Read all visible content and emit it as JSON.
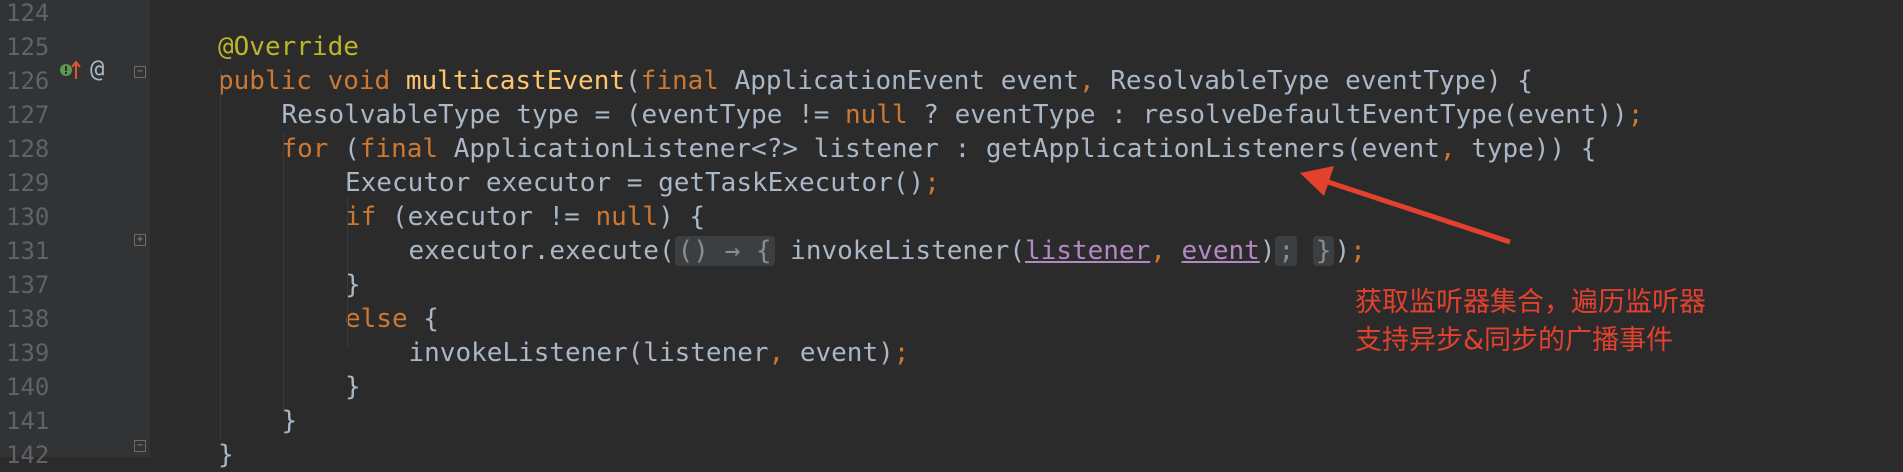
{
  "editor": {
    "lines": [
      {
        "no": "124",
        "indent": 0,
        "tokens": []
      },
      {
        "no": "125",
        "indent": 1,
        "tokens": [
          {
            "t": "@Override",
            "c": "an"
          }
        ]
      },
      {
        "no": "126",
        "indent": 1,
        "tokens": [
          {
            "t": "public ",
            "c": "kw"
          },
          {
            "t": "void ",
            "c": "kw"
          },
          {
            "t": "multicastEvent",
            "c": "fn"
          },
          {
            "t": "(",
            "c": ""
          },
          {
            "t": "final ",
            "c": "kw"
          },
          {
            "t": "ApplicationEvent event",
            "c": ""
          },
          {
            "t": ", ",
            "c": "punc"
          },
          {
            "t": "ResolvableType eventType) {",
            "c": ""
          }
        ]
      },
      {
        "no": "127",
        "indent": 2,
        "tokens": [
          {
            "t": "ResolvableType type = (eventType != ",
            "c": ""
          },
          {
            "t": "null",
            "c": "kw"
          },
          {
            "t": " ? eventType : resolveDefaultEventType(event))",
            "c": ""
          },
          {
            "t": ";",
            "c": "punc"
          }
        ]
      },
      {
        "no": "128",
        "indent": 2,
        "tokens": [
          {
            "t": "for ",
            "c": "kw"
          },
          {
            "t": "(",
            "c": ""
          },
          {
            "t": "final ",
            "c": "kw"
          },
          {
            "t": "ApplicationListener<?> listener : getApplicationListeners(event",
            "c": ""
          },
          {
            "t": ", ",
            "c": "punc"
          },
          {
            "t": "type)) {",
            "c": ""
          }
        ]
      },
      {
        "no": "129",
        "indent": 3,
        "tokens": [
          {
            "t": "Executor executor = getTaskExecutor()",
            "c": ""
          },
          {
            "t": ";",
            "c": "punc"
          }
        ]
      },
      {
        "no": "130",
        "indent": 3,
        "tokens": [
          {
            "t": "if ",
            "c": "kw"
          },
          {
            "t": "(executor != ",
            "c": ""
          },
          {
            "t": "null",
            "c": "kw"
          },
          {
            "t": ") {",
            "c": ""
          }
        ]
      },
      {
        "no": "131",
        "indent": 4,
        "tokens": [
          {
            "t": "executor.execute(",
            "c": ""
          },
          {
            "t": "() → {",
            "c": "lam"
          },
          {
            "t": " invokeListener(",
            "c": ""
          },
          {
            "t": "listener",
            "c": "ul"
          },
          {
            "t": ", ",
            "c": "punc"
          },
          {
            "t": "event",
            "c": "ul"
          },
          {
            "t": ")",
            "c": ""
          },
          {
            "t": ";",
            "c": "lam"
          },
          {
            "t": " ",
            "c": ""
          },
          {
            "t": "}",
            "c": "lam"
          },
          {
            "t": ")",
            "c": ""
          },
          {
            "t": ";",
            "c": "punc"
          }
        ]
      },
      {
        "no": "137",
        "indent": 3,
        "tokens": [
          {
            "t": "}",
            "c": ""
          }
        ]
      },
      {
        "no": "138",
        "indent": 3,
        "tokens": [
          {
            "t": "else ",
            "c": "kw"
          },
          {
            "t": "{",
            "c": ""
          }
        ]
      },
      {
        "no": "139",
        "indent": 4,
        "tokens": [
          {
            "t": "invokeListener(listener",
            "c": ""
          },
          {
            "t": ", ",
            "c": "punc"
          },
          {
            "t": "event)",
            "c": ""
          },
          {
            "t": ";",
            "c": "punc"
          }
        ]
      },
      {
        "no": "140",
        "indent": 3,
        "tokens": [
          {
            "t": "}",
            "c": ""
          }
        ]
      },
      {
        "no": "141",
        "indent": 2,
        "tokens": [
          {
            "t": "}",
            "c": ""
          }
        ]
      },
      {
        "no": "142",
        "indent": 1,
        "tokens": [
          {
            "t": "}",
            "c": ""
          }
        ]
      }
    ],
    "gutter_icons": [
      "implements-icon",
      "override-up-arrow-icon",
      "at-sign-icon"
    ],
    "at_sign": "@"
  },
  "annotation": {
    "line1": "获取监听器集合，遍历监听器",
    "line2": "支持异步&同步的广播事件",
    "color": "#e2412e"
  },
  "theme": {
    "background": "#2b2b2b",
    "keyword": "#cc7832",
    "function": "#ffc66d",
    "annotation": "#bbb529",
    "text": "#a9b7c6",
    "line_number": "#606366"
  }
}
